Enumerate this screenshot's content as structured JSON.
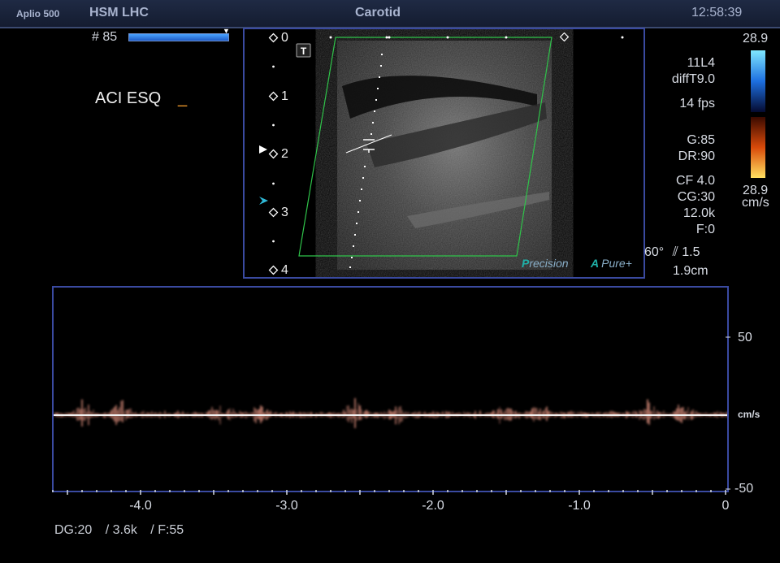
{
  "header": {
    "system_name": "Aplio 500",
    "hospital": "HSM LHC",
    "preset": "Carotid",
    "clock": "12:58:39"
  },
  "frame": {
    "counter": "# 85"
  },
  "annotation": {
    "text": "ACI ESQ",
    "cursor": "_"
  },
  "depth_scale": {
    "labels": [
      "0",
      "1",
      "2",
      "3",
      "4"
    ]
  },
  "settings": {
    "transducer": "11L4",
    "mode": "diffT9.0",
    "frame_rate": "14 fps",
    "gain": "G:85",
    "dynamic_range": "DR:90",
    "cf": "CF 4.0",
    "cg": "CG:30",
    "prf": "12.0k",
    "filter": "F:0",
    "angle": "60°",
    "sample_volume": "1.5",
    "depth": "1.9cm"
  },
  "color_bar": {
    "max": "28.9",
    "min": "28.9",
    "unit": "cm/s"
  },
  "logos": {
    "precision_p": "P",
    "precision": "recision",
    "apure_a": "A",
    "apure": "Pure+"
  },
  "doppler": {
    "velocity_labels": [
      "50",
      "cm/s",
      "-50"
    ],
    "time_labels": [
      "-4.0",
      "-3.0",
      "-2.0",
      "-1.0",
      "0"
    ]
  },
  "footer": {
    "dg": "DG:20",
    "prf": "/ 3.6k",
    "filter": "/ F:55"
  },
  "colors": {
    "panel_border": "#3a4aa0",
    "color_box": "#2fc44a",
    "cursor": "#f29c2b",
    "doppler_signal": "#d98c7a"
  }
}
